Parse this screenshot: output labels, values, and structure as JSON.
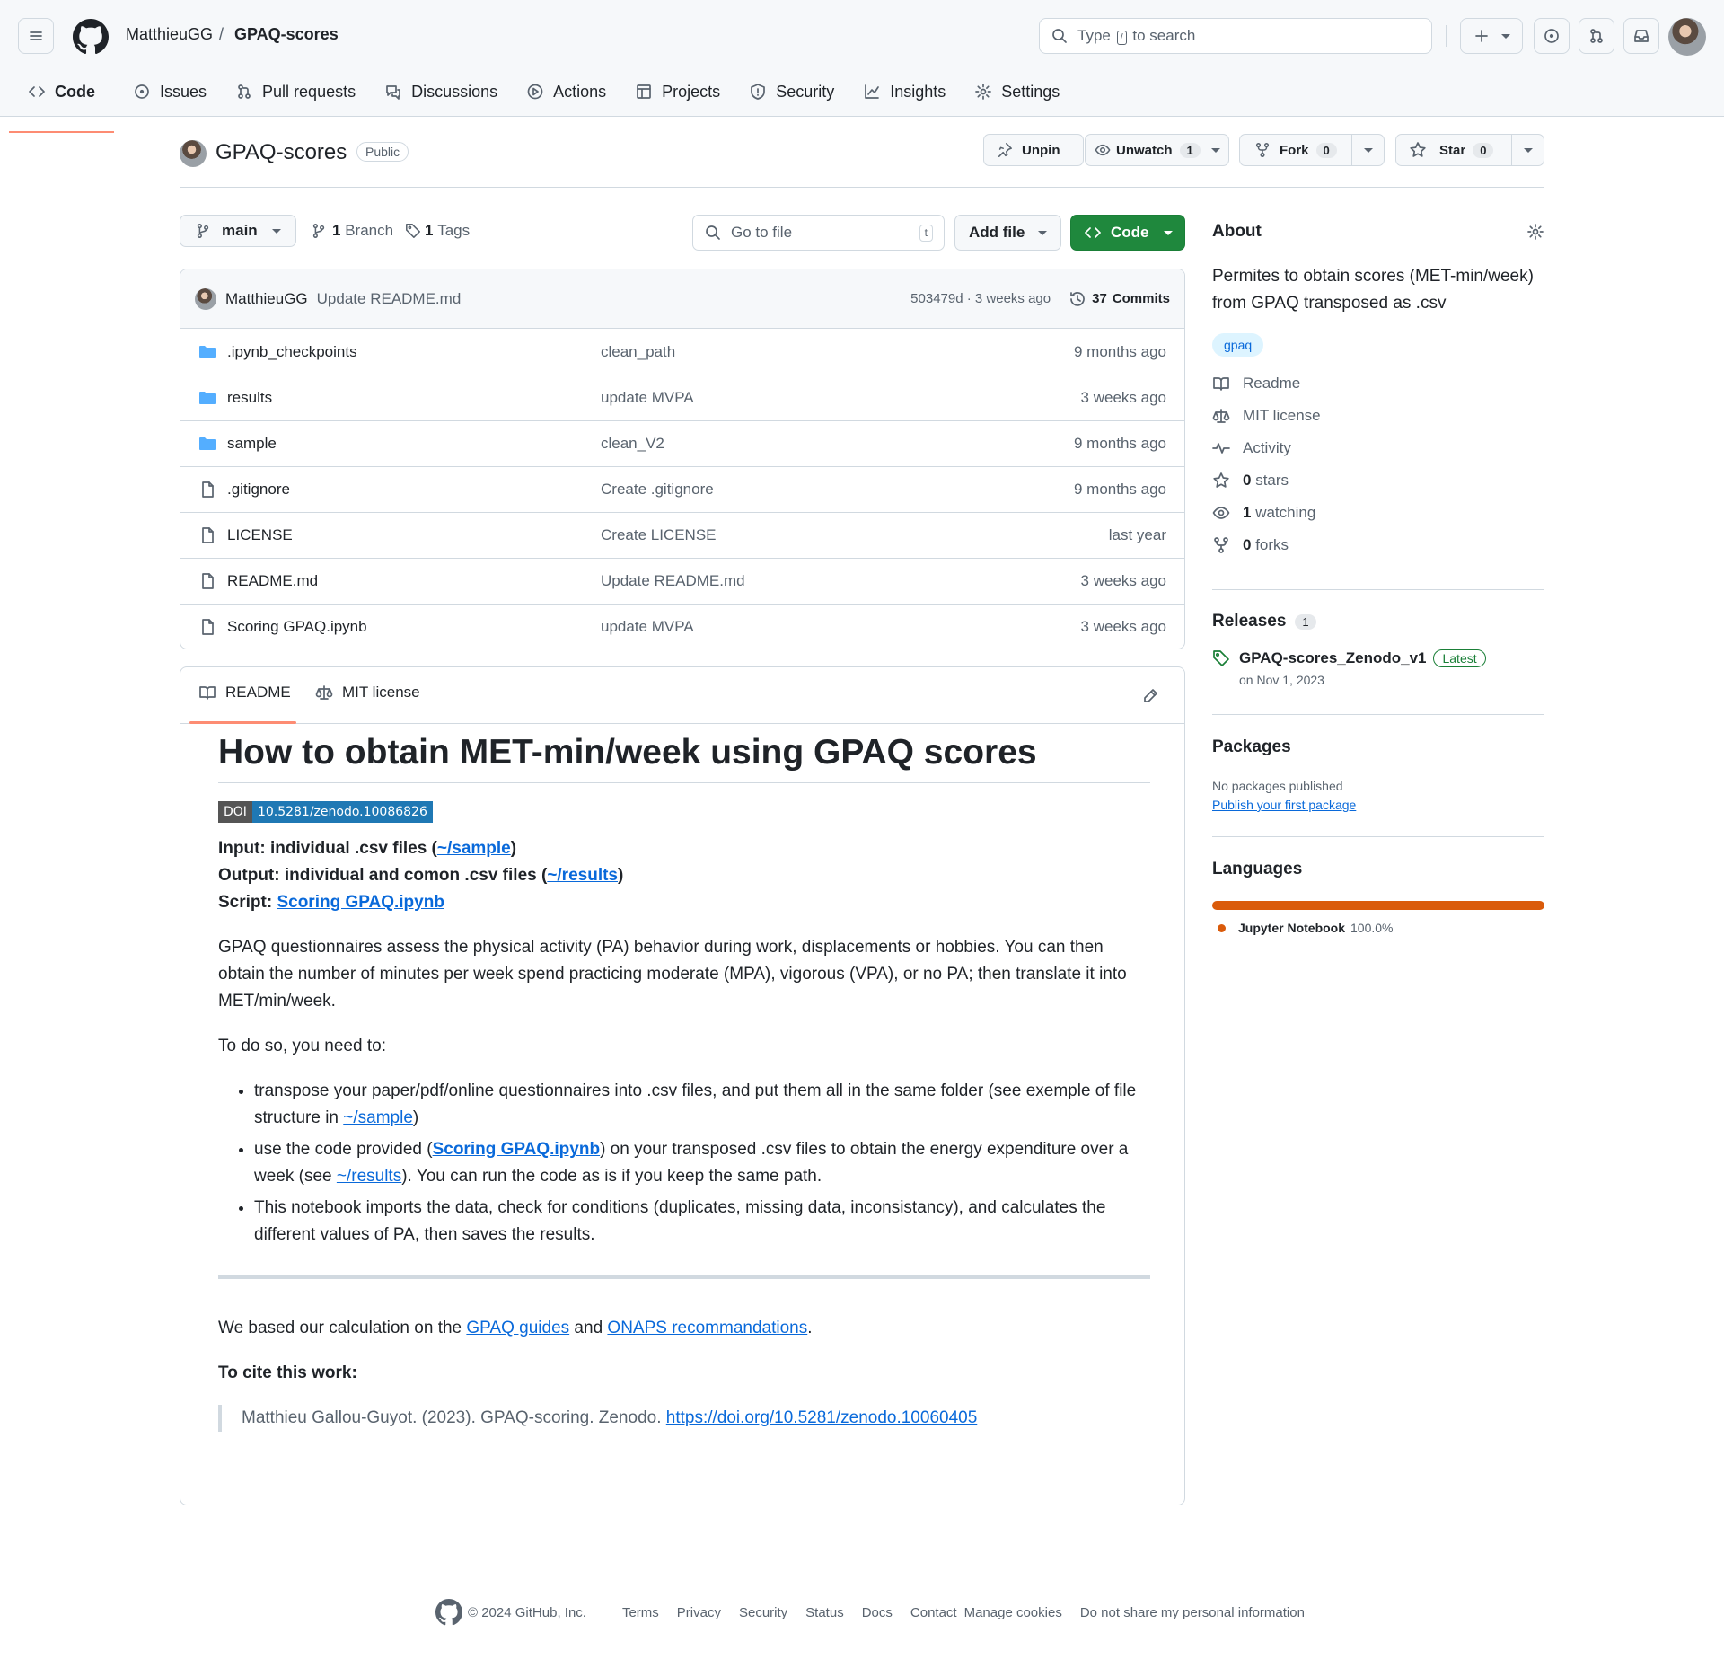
{
  "header": {
    "owner": "MatthieuGG",
    "separator": "/",
    "repo": "GPAQ-scores",
    "search_placeholder_a": "Type",
    "search_key": "/",
    "search_placeholder_b": "to search"
  },
  "tabs": [
    {
      "label": "Code",
      "icon": "code-icon"
    },
    {
      "label": "Issues",
      "icon": "issue-icon"
    },
    {
      "label": "Pull requests",
      "icon": "pull-request-icon"
    },
    {
      "label": "Discussions",
      "icon": "discussion-icon"
    },
    {
      "label": "Actions",
      "icon": "play-icon"
    },
    {
      "label": "Projects",
      "icon": "table-icon"
    },
    {
      "label": "Security",
      "icon": "shield-icon"
    },
    {
      "label": "Insights",
      "icon": "graph-icon"
    },
    {
      "label": "Settings",
      "icon": "gear-icon"
    }
  ],
  "repo": {
    "name": "GPAQ-scores",
    "visibility": "Public",
    "unpin": "Unpin",
    "unwatch": "Unwatch",
    "watch_count": "1",
    "fork": "Fork",
    "fork_count": "0",
    "star": "Star",
    "star_count": "0"
  },
  "toolbar": {
    "branch": "main",
    "branches_count": "1",
    "branches_label": "Branch",
    "tags_count": "1",
    "tags_label": "Tags",
    "goto_placeholder": "Go to file",
    "goto_key": "t",
    "add_file": "Add file",
    "code": "Code"
  },
  "commit": {
    "author": "MatthieuGG",
    "message": "Update README.md",
    "hash_time": "503479d · 3 weeks ago",
    "commits_count": "37",
    "commits_label": "Commits"
  },
  "files": [
    {
      "type": "folder",
      "name": ".ipynb_checkpoints",
      "message": "clean_path",
      "date": "9 months ago"
    },
    {
      "type": "folder",
      "name": "results",
      "message": "update MVPA",
      "date": "3 weeks ago"
    },
    {
      "type": "folder",
      "name": "sample",
      "message": "clean_V2",
      "date": "9 months ago"
    },
    {
      "type": "file",
      "name": ".gitignore",
      "message": "Create .gitignore",
      "date": "9 months ago"
    },
    {
      "type": "file",
      "name": "LICENSE",
      "message": "Create LICENSE",
      "date": "last year"
    },
    {
      "type": "file",
      "name": "README.md",
      "message": "Update README.md",
      "date": "3 weeks ago"
    },
    {
      "type": "file",
      "name": "Scoring GPAQ.ipynb",
      "message": "update MVPA",
      "date": "3 weeks ago"
    }
  ],
  "readme": {
    "tab_readme": "README",
    "tab_license": "MIT license",
    "title": "How to obtain MET-min/week using GPAQ scores",
    "doi_label": "DOI",
    "doi_value": "10.5281/zenodo.10086826",
    "input_label": "Input: individual .csv files (",
    "input_link": "~/sample",
    "output_label": "Output: individual and comon .csv files (",
    "output_link": "~/results",
    "script_label": "Script: ",
    "script_link": "Scoring GPAQ.ipynb",
    "close_paren": ")",
    "para1": "GPAQ questionnaires assess the physical activity (PA) behavior during work, displacements or hobbies. You can then obtain the number of minutes per week spend practicing moderate (MPA), vigorous (VPA), or no PA; then translate it into MET/min/week.",
    "para2": "To do so, you need to:",
    "li1_a": "transpose your paper/pdf/online questionnaires into .csv files, and put them all in the same folder (see exemple of file structure in ",
    "li1_link": "~/sample",
    "li1_b": ")",
    "li2_a": "use the code provided (",
    "li2_link1": "Scoring GPAQ.ipynb",
    "li2_b": ") on your transposed .csv files to obtain the energy expenditure over a week (see ",
    "li2_link2": "~/results",
    "li2_c": "). You can run the code as is if you keep the same path.",
    "li3": "This notebook imports the data, check for conditions (duplicates, missing data, inconsistancy), and calculates the different values of PA, then saves the results.",
    "based_a": "We based our calculation on the ",
    "based_link1": "GPAQ guides",
    "based_and": " and ",
    "based_link2": "ONAPS recommandations",
    "based_dot": ".",
    "cite_heading": "To cite this work:",
    "cite_text": "Matthieu Gallou-Guyot. (2023). GPAQ-scoring. Zenodo. ",
    "cite_link": "https://doi.org/10.5281/zenodo.10060405"
  },
  "about": {
    "heading": "About",
    "description": "Permites to obtain scores (MET-min/week) from GPAQ transposed as .csv",
    "topic": "gpaq",
    "items": [
      {
        "icon": "book-icon",
        "bold": "",
        "label": "Readme"
      },
      {
        "icon": "law-icon",
        "bold": "",
        "label": "MIT license"
      },
      {
        "icon": "pulse-icon",
        "bold": "",
        "label": "Activity"
      },
      {
        "icon": "star-icon",
        "bold": "0",
        "label": " stars"
      },
      {
        "icon": "eye-icon",
        "bold": "1",
        "label": " watching"
      },
      {
        "icon": "fork-icon",
        "bold": "0",
        "label": " forks"
      }
    ]
  },
  "releases": {
    "heading": "Releases",
    "count": "1",
    "name": "GPAQ-scores_Zenodo_v1",
    "badge": "Latest",
    "date": "on Nov 1, 2023"
  },
  "packages": {
    "heading": "Packages",
    "none": "No packages published",
    "link": "Publish your first package"
  },
  "languages": {
    "heading": "Languages",
    "items": [
      {
        "name": "Jupyter Notebook",
        "percent": "100.0%",
        "fraction": 1.0,
        "color": "#DA5B0B"
      }
    ]
  },
  "footer": {
    "copyright": "© 2024 GitHub, Inc.",
    "links": [
      "Terms",
      "Privacy",
      "Security",
      "Status",
      "Docs",
      "Contact",
      "Manage cookies",
      "Do not share my personal information"
    ]
  }
}
